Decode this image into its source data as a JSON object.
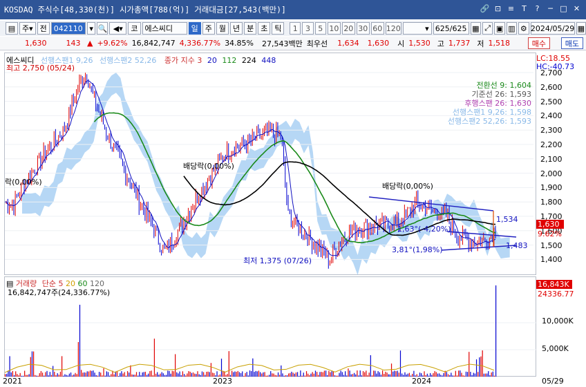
{
  "window": {
    "title": "KOSDAQ 주식수[48,330(천)] 시가총액[788(억)] 거래대금[27,543(백만)]",
    "buttons": [
      "🔗",
      "⊡",
      "≡",
      "T",
      "?",
      "─",
      "□",
      "✕"
    ]
  },
  "toolbar": {
    "code": "042110",
    "code_btn": "코",
    "stock_name": "에스씨디",
    "market_sel": "주",
    "prev": "전",
    "periods": [
      "일",
      "주",
      "월",
      "년",
      "분",
      "초",
      "틱"
    ],
    "minutes": [
      "1",
      "3",
      "5",
      "10",
      "20",
      "30",
      "60",
      "120"
    ],
    "count": "625/625",
    "date": "2024/05/29"
  },
  "quote": {
    "price": "1,630",
    "change": "143",
    "change_pct": "+9.62%",
    "volume": "16,842,747",
    "volume_pct": "4,336.77%",
    "turnover": "34.85%",
    "amount": "27,543백만",
    "best_label": "최우선",
    "best_ask": "1,634",
    "best_bid": "1,630",
    "open_label": "시",
    "open": "1,530",
    "high_label": "고",
    "high": "1,737",
    "low_label": "저",
    "low": "1,518",
    "buy": "매수",
    "sell": "매도"
  },
  "legend": {
    "name": "에스씨디",
    "span1": "선행스팬1 9,26",
    "span2": "선행스팬2 52,26",
    "ma": "종가 지수 3",
    "ma2": "20",
    "ma3": "112",
    "ma4": "224",
    "ma5": "448",
    "lc": "LC:18.55",
    "hc": "HC:-40.73"
  },
  "ichimoku": {
    "conv": "전환선 9: 1,604",
    "base": "기준선 26: 1,593",
    "lag": "후행스팬 26: 1,630",
    "span1": "선행스팬1 9,26: 1,598",
    "span2": "선행스팬2 52,26: 1,593"
  },
  "annotations": {
    "high": "최고 2,750 (05/24)",
    "low": "최저 1,375 (07/26)",
    "div1": "배당락(0,00%)",
    "div2": "배당락(0,00%)",
    "left_div": "락(0,00%)",
    "tri1": "1,63°(-4,20%)",
    "tri2": "3,81°(1,98%)",
    "val1534": "1,534",
    "val1483": "1,483"
  },
  "price_axis": [
    "2,700",
    "2,600",
    "2,500",
    "2,400",
    "2,300",
    "2,200",
    "2,100",
    "2,000",
    "1,900",
    "1,800",
    "1,700",
    "1,600",
    "1,500",
    "1,400"
  ],
  "current_label": "1,630",
  "current_pct": "9.62%",
  "volume_panel": {
    "title": "거래량",
    "ma_title": "단순",
    "ma1": "5",
    "ma2": "20",
    "ma3": "60",
    "ma4": "120",
    "value": "16,842,747주(24,336.77%)",
    "axis": [
      "10,000K",
      "5,000K"
    ],
    "cur": "16,843K",
    "cur_pct": "24336.77"
  },
  "x_axis": [
    "2021",
    "2023",
    "2024",
    "05/29"
  ],
  "colors": {
    "up": "#e00000",
    "down": "#0000d0",
    "cloud": "#9ec9f2",
    "ma_black": "#000000",
    "ma_green": "#1a8a1a",
    "ma_blue": "#1010c0"
  }
}
